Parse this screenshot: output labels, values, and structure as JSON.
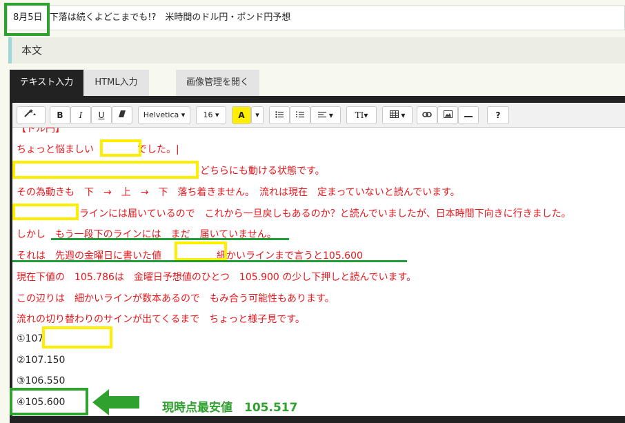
{
  "title": {
    "date": "8月5日",
    "text": "下落は続くよどこまでも!?　米時間のドル円・ポンド円予想"
  },
  "section_heading": "本文",
  "tabs": {
    "text_input": "テキスト入力",
    "html_input": "HTML入力",
    "image_manager": "画像管理を開く"
  },
  "toolbar": {
    "magic_icon": "magic-wand-icon",
    "bold": "B",
    "italic": "I",
    "underline": "U",
    "eraser_icon": "eraser-icon",
    "font_family": "Helvetica",
    "font_size": "16",
    "color_letter": "A",
    "list_ul_icon": "list-ul-icon",
    "list_ol_icon": "list-ol-icon",
    "align_icon": "align-left-icon",
    "text_style": "TI",
    "table_icon": "table-icon",
    "link_icon": "link-icon",
    "image_icon": "image-icon",
    "hr_icon": "horizontal-rule-icon",
    "help": "?",
    "highlight_color": "#ffee00"
  },
  "content": {
    "partial_top": "【ドル円】",
    "line1_a": "ちょっと悩ましい",
    "line1_b": "でした。|",
    "line2": "どちらにも動ける状態です。",
    "line3": "その為動きも　下　→　上　→　下　落ち着きません。　流れは現在　定まっていないと読んでいます。",
    "line4": "ラインには届いているので　これから一旦戻しもあるのか？と読んでいましたが、日本時間下向きに行きました。",
    "line5": "しかし　もう一段下のラインには　まだ　届いていません。",
    "line6_a": "それは　先週の金曜日に書いた値",
    "line6_b": "細かいラインまで言うと105.600",
    "line7": "現在下値の　105.786は　金曜日予想値のひとつ　105.900 の少し下押しと読んでいます。",
    "line8": "この辺りは　細かいラインが数本あるので　もみ合う可能性もあります。",
    "line9": "流れの切り替わりのサインが出てくるまで　ちょっと様子見です。",
    "item1": "①107",
    "item2": "②107.150",
    "item3": "③106.550",
    "item4": "④105.600"
  },
  "annotation": {
    "label": "現時点最安値　105.517",
    "color": "#2ea12e"
  }
}
